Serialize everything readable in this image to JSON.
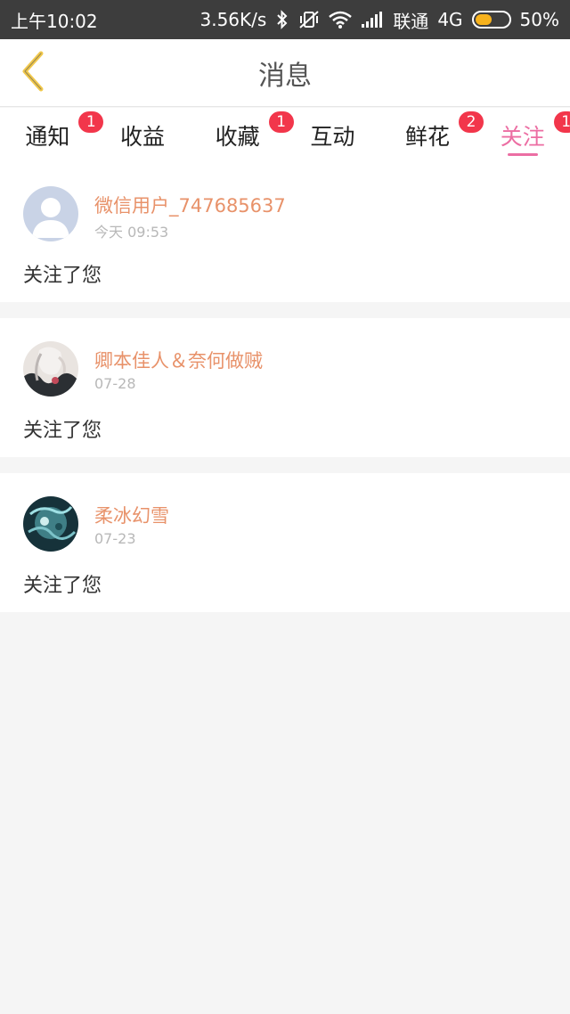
{
  "status_bar": {
    "time": "上午10:02",
    "net_speed": "3.56K/s",
    "carrier": "联通",
    "network": "4G",
    "battery_text": "50%",
    "battery_level": 0.5,
    "icons": [
      "bluetooth-icon",
      "mute-vibrate-icon",
      "wifi-icon",
      "signal-icon",
      "battery-icon"
    ]
  },
  "header": {
    "title": "消息",
    "back_icon": "chevron-left-icon"
  },
  "tabs": [
    {
      "label": "通知",
      "badge": "1",
      "active": false
    },
    {
      "label": "收益",
      "badge": "",
      "active": false
    },
    {
      "label": "收藏",
      "badge": "1",
      "active": false
    },
    {
      "label": "互动",
      "badge": "",
      "active": false
    },
    {
      "label": "鲜花",
      "badge": "2",
      "active": false
    },
    {
      "label": "关注",
      "badge": "1",
      "active": true
    }
  ],
  "notifications": [
    {
      "user": "微信用户_747685637",
      "time": "今天 09:53",
      "text": "关注了您",
      "avatar": "default-avatar-icon"
    },
    {
      "user": "卿本佳人＆奈何做贼",
      "time": "07-28",
      "text": "关注了您",
      "avatar": "user-avatar"
    },
    {
      "user": "柔冰幻雪",
      "time": "07-23",
      "text": "关注了您",
      "avatar": "user-avatar"
    }
  ],
  "colors": {
    "accent": "#ec6ea3",
    "username": "#e8926a",
    "badge": "#f2364b",
    "back_icon": "#f2c94c",
    "statusbar": "#3d3d3d"
  }
}
